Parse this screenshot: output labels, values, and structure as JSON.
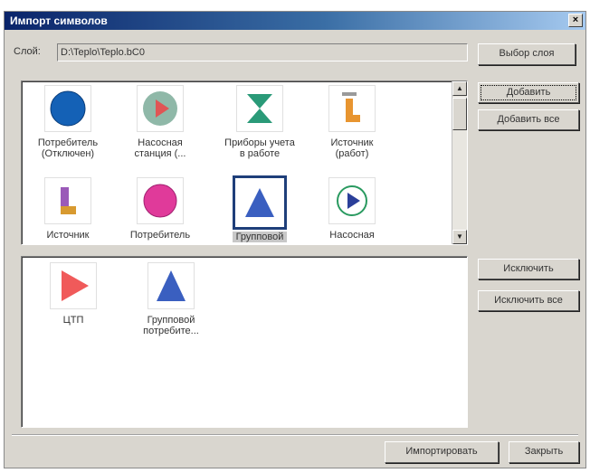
{
  "window": {
    "title": "Импорт символов",
    "close_glyph": "×"
  },
  "layer": {
    "label": "Слой:",
    "value": "D:\\Teplo\\Teplo.bC0",
    "choose_button": "Выбор слоя"
  },
  "actions": {
    "add": "Добавить",
    "add_all": "Добавить все",
    "exclude": "Исключить",
    "exclude_all": "Исключить все",
    "import": "Импортировать",
    "close": "Закрыть"
  },
  "scrollbar": {
    "up": "▲",
    "down": "▼"
  },
  "available_symbols": [
    {
      "label": "Потребитель (Отключен)",
      "icon": "blue-circle-icon"
    },
    {
      "label": "Насосная станция (...",
      "icon": "pump-station-gray-icon"
    },
    {
      "label": "Приборы учета в работе",
      "icon": "hourglass-meter-icon"
    },
    {
      "label": "Источник (работ)",
      "icon": "source-working-icon"
    },
    {
      "label": "Источник",
      "icon": "source-purple-icon"
    },
    {
      "label": "Потребитель",
      "icon": "pink-circle-icon"
    },
    {
      "label": "Групповой",
      "icon": "blue-triangle-icon",
      "selected": true
    },
    {
      "label": "Насосная",
      "icon": "pump-station-green-icon"
    }
  ],
  "selected_symbols": [
    {
      "label": "ЦТП",
      "icon": "red-triangle-icon"
    },
    {
      "label": "Групповой потребите...",
      "icon": "blue-triangle-icon"
    }
  ],
  "colors": {
    "title_start": "#0a246a",
    "title_end": "#a6caf0",
    "dialog_bg": "#d9d6cf",
    "selection_border": "#1f3f7a"
  }
}
